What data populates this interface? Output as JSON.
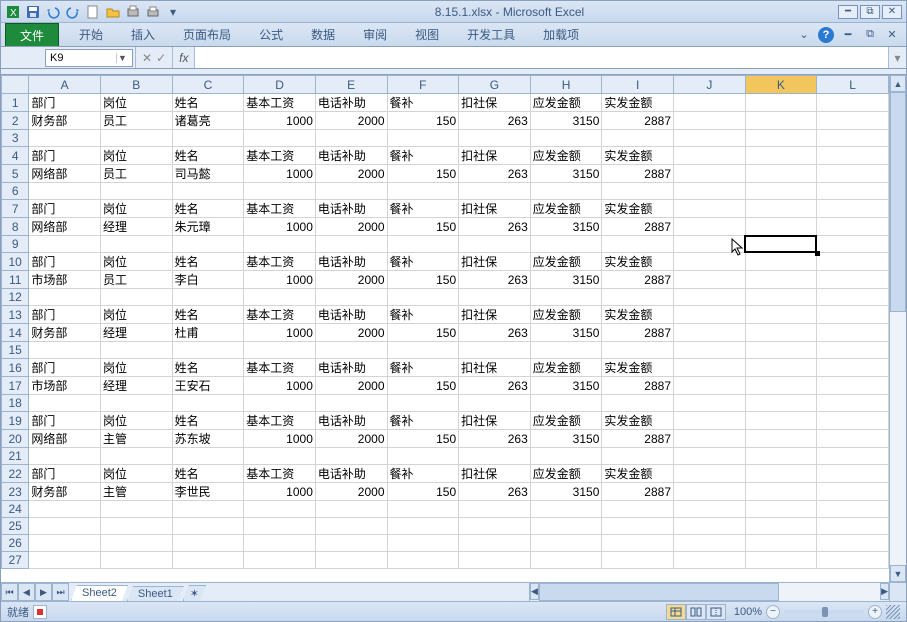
{
  "title": "8.15.1.xlsx - Microsoft Excel",
  "ribbon": {
    "file": "文件",
    "home": "开始",
    "insert": "插入",
    "layout": "页面布局",
    "formula": "公式",
    "data": "数据",
    "review": "审阅",
    "view": "视图",
    "dev": "开发工具",
    "addin": "加载项"
  },
  "namebox": "K9",
  "formula": "",
  "columns": [
    "A",
    "B",
    "C",
    "D",
    "E",
    "F",
    "G",
    "H",
    "I",
    "J",
    "K",
    "L"
  ],
  "active": {
    "col": "K",
    "row": 9
  },
  "headers": {
    "dept": "部门",
    "pos": "岗位",
    "name": "姓名",
    "base": "基本工资",
    "tel": "电话补助",
    "meal": "餐补",
    "ins": "扣社保",
    "gross": "应发金额",
    "net": "实发金额"
  },
  "records": [
    {
      "dept": "财务部",
      "pos": "员工",
      "name": "诸葛亮",
      "base": 1000,
      "tel": 2000,
      "meal": 150,
      "ins": 263,
      "gross": 3150,
      "net": 2887
    },
    {
      "dept": "网络部",
      "pos": "员工",
      "name": "司马懿",
      "base": 1000,
      "tel": 2000,
      "meal": 150,
      "ins": 263,
      "gross": 3150,
      "net": 2887
    },
    {
      "dept": "网络部",
      "pos": "经理",
      "name": "朱元璋",
      "base": 1000,
      "tel": 2000,
      "meal": 150,
      "ins": 263,
      "gross": 3150,
      "net": 2887
    },
    {
      "dept": "市场部",
      "pos": "员工",
      "name": "李白",
      "base": 1000,
      "tel": 2000,
      "meal": 150,
      "ins": 263,
      "gross": 3150,
      "net": 2887
    },
    {
      "dept": "财务部",
      "pos": "经理",
      "name": "杜甫",
      "base": 1000,
      "tel": 2000,
      "meal": 150,
      "ins": 263,
      "gross": 3150,
      "net": 2887
    },
    {
      "dept": "市场部",
      "pos": "经理",
      "name": "王安石",
      "base": 1000,
      "tel": 2000,
      "meal": 150,
      "ins": 263,
      "gross": 3150,
      "net": 2887
    },
    {
      "dept": "网络部",
      "pos": "主管",
      "name": "苏东坡",
      "base": 1000,
      "tel": 2000,
      "meal": 150,
      "ins": 263,
      "gross": 3150,
      "net": 2887
    },
    {
      "dept": "财务部",
      "pos": "主管",
      "name": "李世民",
      "base": 1000,
      "tel": 2000,
      "meal": 150,
      "ins": 263,
      "gross": 3150,
      "net": 2887
    }
  ],
  "sheets": {
    "s1": "Sheet2",
    "s2": "Sheet1"
  },
  "status": {
    "ready": "就绪",
    "zoom": "100%"
  }
}
